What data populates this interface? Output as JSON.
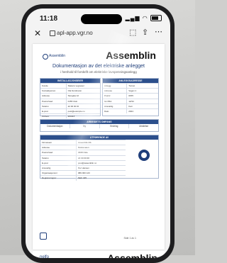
{
  "status": {
    "time": "11:18"
  },
  "browser": {
    "url": "apl-app.vgr.no"
  },
  "document": {
    "brand": "Assemblin",
    "logo": "Assemblin",
    "title": "Dokumentasjon av det elektriske anlegget",
    "subtitle": "i henhold til forskrift om elektriske lavspenningsanlegg",
    "installer_panel": {
      "header": "INSTALLASJONSEIER",
      "rows": [
        {
          "label": "Kunde",
          "value": "Statens vegvesen"
        },
        {
          "label": "Kontaktperson",
          "value": "Ola Nordmann"
        },
        {
          "label": "Adresse",
          "value": "Storgata 12"
        },
        {
          "label": "Postnr/sted",
          "value": "0155 Oslo"
        },
        {
          "label": "Telefon",
          "value": "22 00 00 00"
        },
        {
          "label": "E-post",
          "value": "post@example.no"
        },
        {
          "label": "Ordrenr",
          "value": "204118"
        }
      ]
    },
    "object_panel": {
      "header": "ANLEGGSADRESSE",
      "rows": [
        {
          "label": "Anlegg",
          "value": "Tunnel"
        },
        {
          "label": "Adresse",
          "value": "Vegen 1"
        },
        {
          "label": "Postnr",
          "value": "0155"
        },
        {
          "label": "Gnr/Bnr",
          "value": "12/34"
        },
        {
          "label": "Ansvarlig",
          "value": "Kari"
        },
        {
          "label": "Dato",
          "value": "2024"
        }
      ]
    },
    "work_panel": {
      "header": "ARBEIDETS OMFANG",
      "cols": [
        "Dokumentasjon",
        "Ny",
        "Endring",
        "Utvidelse"
      ]
    },
    "contractor_panel": {
      "header": "UTFØRENDE AV",
      "rows": [
        {
          "label": "Firmanavn",
          "value": "Assemblin AS"
        },
        {
          "label": "Adresse",
          "value": "Bekkeveien"
        },
        {
          "label": "Postnr/sted",
          "value": "0668 Oslo"
        },
        {
          "label": "Telefon",
          "value": "22 00 00 00"
        },
        {
          "label": "E-post",
          "value": "post@assemblin.no"
        },
        {
          "label": "Ansvarlig",
          "value": "Per Hansen"
        },
        {
          "label": "Organisasjonsnr",
          "value": "989 000 123"
        },
        {
          "label": "Registreringsnr",
          "value": "NEK 405"
        }
      ]
    },
    "page_label": "Side 1 av 1"
  },
  "next_document": {
    "logo": "nelfo",
    "brand": "Assemblin"
  }
}
